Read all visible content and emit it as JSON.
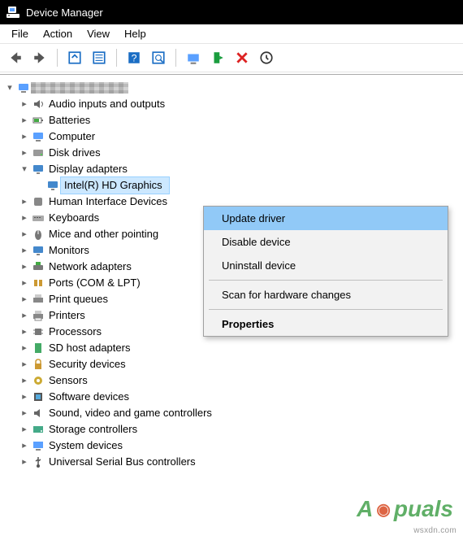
{
  "title": "Device Manager",
  "menu": {
    "file": "File",
    "action": "Action",
    "view": "View",
    "help": "Help"
  },
  "tree": {
    "root": "",
    "items": [
      {
        "label": "Audio inputs and outputs"
      },
      {
        "label": "Batteries"
      },
      {
        "label": "Computer"
      },
      {
        "label": "Disk drives"
      },
      {
        "label": "Display adapters"
      },
      {
        "label": "Intel(R) HD Graphics"
      },
      {
        "label": "Human Interface Devices"
      },
      {
        "label": "Keyboards"
      },
      {
        "label": "Mice and other pointing"
      },
      {
        "label": "Monitors"
      },
      {
        "label": "Network adapters"
      },
      {
        "label": "Ports (COM & LPT)"
      },
      {
        "label": "Print queues"
      },
      {
        "label": "Printers"
      },
      {
        "label": "Processors"
      },
      {
        "label": "SD host adapters"
      },
      {
        "label": "Security devices"
      },
      {
        "label": "Sensors"
      },
      {
        "label": "Software devices"
      },
      {
        "label": "Sound, video and game controllers"
      },
      {
        "label": "Storage controllers"
      },
      {
        "label": "System devices"
      },
      {
        "label": "Universal Serial Bus controllers"
      }
    ]
  },
  "context": {
    "update": "Update driver",
    "disable": "Disable device",
    "uninstall": "Uninstall device",
    "scan": "Scan for hardware changes",
    "properties": "Properties"
  },
  "watermark": "wsxdn.com",
  "brand_left": "A",
  "brand_right": "puals"
}
